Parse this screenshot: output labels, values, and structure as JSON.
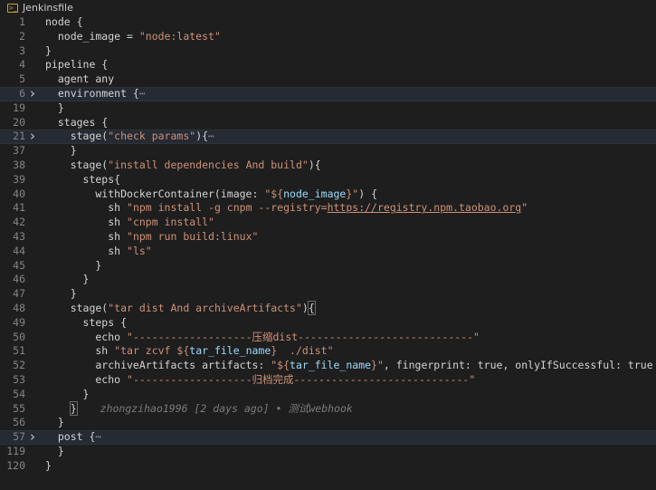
{
  "tab": {
    "title": "Jenkinsfile",
    "icon": "jenkins-file-icon"
  },
  "lines": [
    {
      "n": "1",
      "text": "node {"
    },
    {
      "n": "2",
      "text": "  node_image = \"node:latest\""
    },
    {
      "n": "3",
      "text": "}"
    },
    {
      "n": "4",
      "text": "pipeline {"
    },
    {
      "n": "5",
      "text": "  agent any"
    },
    {
      "n": "6",
      "text": "  environment {",
      "fold": true,
      "folded": "…"
    },
    {
      "n": "19",
      "text": "  }"
    },
    {
      "n": "20",
      "text": "  stages {"
    },
    {
      "n": "21",
      "text": "    stage(\"check params\"){",
      "fold": true,
      "folded": "…"
    },
    {
      "n": "37",
      "text": "    }"
    },
    {
      "n": "38",
      "text": "    stage(\"install dependencies And build\"){"
    },
    {
      "n": "39",
      "text": "      steps{"
    },
    {
      "n": "40",
      "text": "        withDockerContainer(image: \"${node_image}\") {"
    },
    {
      "n": "41",
      "text": "          sh \"npm install -g cnpm --registry=https://registry.npm.taobao.org\""
    },
    {
      "n": "42",
      "text": "          sh \"cnpm install\""
    },
    {
      "n": "43",
      "text": "          sh \"npm run build:linux\""
    },
    {
      "n": "44",
      "text": "          sh \"ls\""
    },
    {
      "n": "45",
      "text": "        }"
    },
    {
      "n": "46",
      "text": "      }"
    },
    {
      "n": "47",
      "text": "    }"
    },
    {
      "n": "48",
      "text": "    stage(\"tar dist And archiveArtifacts\"){"
    },
    {
      "n": "49",
      "text": "      steps {"
    },
    {
      "n": "50",
      "text": "        echo \"-------------------压缩dist----------------------------\""
    },
    {
      "n": "51",
      "text": "        sh \"tar zcvf ${tar_file_name}  ./dist\""
    },
    {
      "n": "52",
      "text": "        archiveArtifacts artifacts: \"${tar_file_name}\", fingerprint: true, onlyIfSuccessful: true"
    },
    {
      "n": "53",
      "text": "        echo \"-------------------归档完成----------------------------\""
    },
    {
      "n": "54",
      "text": "      }"
    },
    {
      "n": "55",
      "text": "    }",
      "blame": "zhongzihao1996 [2 days ago] • 测试webhook"
    },
    {
      "n": "56",
      "text": "  }"
    },
    {
      "n": "57",
      "text": "  post {",
      "fold": true,
      "folded": "…"
    },
    {
      "n": "119",
      "text": "  }"
    },
    {
      "n": "120",
      "text": "}"
    },
    {
      "n": "",
      "text": ""
    }
  ],
  "display": [
    {
      "n": "1",
      "segs": [
        [
          "f",
          "node {"
        ]
      ]
    },
    {
      "n": "2",
      "segs": [
        [
          "f",
          "  node_image = "
        ],
        [
          "s",
          "\"node:latest\""
        ]
      ]
    },
    {
      "n": "3",
      "segs": [
        [
          "f",
          "}"
        ]
      ]
    },
    {
      "n": "4",
      "segs": [
        [
          "f",
          "pipeline {"
        ]
      ]
    },
    {
      "n": "5",
      "segs": [
        [
          "f",
          "  agent any"
        ]
      ]
    },
    {
      "n": "6",
      "segs": [
        [
          "f",
          "  environment {"
        ],
        [
          "dots",
          "⋯"
        ]
      ],
      "fold": true,
      "hl": true
    },
    {
      "n": "19",
      "segs": [
        [
          "f",
          "  }"
        ]
      ]
    },
    {
      "n": "20",
      "segs": [
        [
          "f",
          "  stages {"
        ]
      ]
    },
    {
      "n": "21",
      "segs": [
        [
          "f",
          "    stage("
        ],
        [
          "s",
          "\"check params\""
        ],
        [
          "f",
          "){"
        ],
        [
          "dots",
          "⋯"
        ]
      ],
      "fold": true,
      "hl": true
    },
    {
      "n": "37",
      "segs": [
        [
          "f",
          "    }"
        ]
      ]
    },
    {
      "n": "38",
      "segs": [
        [
          "f",
          "    stage("
        ],
        [
          "s",
          "\"install dependencies And build\""
        ],
        [
          "f",
          "){"
        ]
      ]
    },
    {
      "n": "39",
      "segs": [
        [
          "f",
          "      steps{"
        ]
      ]
    },
    {
      "n": "40",
      "segs": [
        [
          "f",
          "        withDockerContainer(image: "
        ],
        [
          "s",
          "\"${"
        ],
        [
          "v",
          "node_image"
        ],
        [
          "s",
          "}\""
        ],
        [
          "f",
          ") {"
        ]
      ]
    },
    {
      "n": "41",
      "segs": [
        [
          "f",
          "          sh "
        ],
        [
          "s",
          "\"npm install -g cnpm --registry="
        ],
        [
          "su",
          "https://registry.npm.taobao.org"
        ],
        [
          "s",
          "\""
        ]
      ]
    },
    {
      "n": "42",
      "segs": [
        [
          "f",
          "          sh "
        ],
        [
          "s",
          "\"cnpm install\""
        ]
      ]
    },
    {
      "n": "43",
      "segs": [
        [
          "f",
          "          sh "
        ],
        [
          "s",
          "\"npm run build:linux\""
        ]
      ]
    },
    {
      "n": "44",
      "segs": [
        [
          "f",
          "          sh "
        ],
        [
          "s",
          "\"ls\""
        ]
      ]
    },
    {
      "n": "45",
      "segs": [
        [
          "f",
          "        }"
        ]
      ]
    },
    {
      "n": "46",
      "segs": [
        [
          "f",
          "      }"
        ]
      ]
    },
    {
      "n": "47",
      "segs": [
        [
          "f",
          "    }"
        ]
      ]
    },
    {
      "n": "48",
      "segs": [
        [
          "f",
          "    stage("
        ],
        [
          "s",
          "\"tar dist And archiveArtifacts\""
        ],
        [
          "f",
          ")"
        ],
        [
          "b",
          "{"
        ]
      ]
    },
    {
      "n": "49",
      "segs": [
        [
          "f",
          "      steps {"
        ]
      ]
    },
    {
      "n": "50",
      "segs": [
        [
          "f",
          "        echo "
        ],
        [
          "s",
          "\"-------------------压缩dist----------------------------\""
        ]
      ]
    },
    {
      "n": "51",
      "segs": [
        [
          "f",
          "        sh "
        ],
        [
          "s",
          "\"tar zcvf ${"
        ],
        [
          "v",
          "tar_file_name"
        ],
        [
          "s",
          "}  ./dist\""
        ]
      ]
    },
    {
      "n": "52",
      "segs": [
        [
          "f",
          "        archiveArtifacts artifacts: "
        ],
        [
          "s",
          "\"${"
        ],
        [
          "v",
          "tar_file_name"
        ],
        [
          "s",
          "}\""
        ],
        [
          "f",
          ", fingerprint: true, onlyIfSuccessful: true"
        ]
      ]
    },
    {
      "n": "53",
      "segs": [
        [
          "f",
          "        echo "
        ],
        [
          "s",
          "\"-------------------归档完成----------------------------\""
        ]
      ]
    },
    {
      "n": "54",
      "segs": [
        [
          "f",
          "      }"
        ]
      ]
    },
    {
      "n": "55",
      "segs": [
        [
          "f",
          "    "
        ],
        [
          "b",
          "}"
        ]
      ],
      "blame": "zhongzihao1996 [2 days ago] • 测试webhook"
    },
    {
      "n": "56",
      "segs": [
        [
          "f",
          "  }"
        ]
      ]
    },
    {
      "n": "57",
      "segs": [
        [
          "f",
          "  post {"
        ],
        [
          "dots",
          "⋯"
        ]
      ],
      "fold": true,
      "hl": true
    },
    {
      "n": "119",
      "segs": [
        [
          "f",
          "  }"
        ]
      ]
    },
    {
      "n": "120",
      "segs": [
        [
          "f",
          "}"
        ]
      ]
    }
  ],
  "colors": {
    "background": "#1e1e1e",
    "string": "#ce9178",
    "variable": "#9cdcfe",
    "text": "#d4d4d4",
    "line_number": "#858585",
    "folded_highlight": "#252a33"
  },
  "icons": {
    "fold": "chevron-right-icon"
  }
}
